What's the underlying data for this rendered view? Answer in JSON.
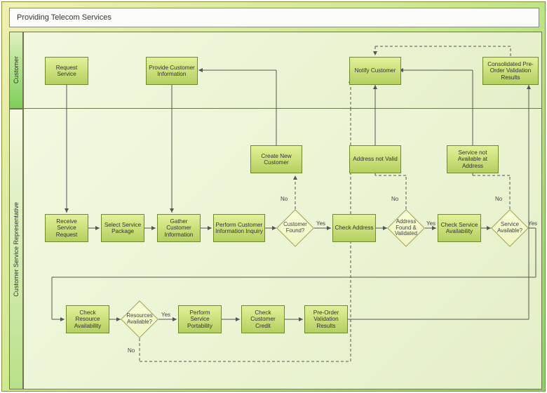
{
  "title": "Providing Telecom Services",
  "lanes": {
    "customer": "Customer",
    "csr": "Customer Service Representative"
  },
  "tasks": {
    "request_service": "Request Service",
    "provide_info": "Provide Customer Information",
    "notify_customer": "Notify Customer",
    "consolidated": "Consolidated Pre-Order Validation Results",
    "receive_request": "Receive Service Request",
    "select_package": "Select Service Package",
    "gather_info": "Gather Customer Information",
    "perform_inquiry": "Perform Customer Information Inquiry",
    "create_customer": "Create New Customer",
    "check_address": "Check Address",
    "addr_not_valid": "Address not Valid",
    "check_service": "Check Service Availability",
    "svc_not_avail": "Service not Available at Address",
    "check_resource": "Check Resource Availability",
    "perform_port": "Perform Service Portability",
    "check_credit": "Check Customer Credit",
    "preorder_results": "Pre-Order Validation Results"
  },
  "gateways": {
    "customer_found": "Customer Found?",
    "addr_validated": "Address Found & Validated",
    "service_avail": "Service Available?",
    "resources_avail": "Resources Available?"
  },
  "labels": {
    "yes": "Yes",
    "no": "No"
  },
  "chart_data": {
    "type": "table",
    "description": "BPMN swimlane flowchart with two lanes: Customer and Customer Service Representative",
    "nodes": [
      {
        "id": "request_service",
        "lane": "customer",
        "type": "task",
        "label": "Request Service"
      },
      {
        "id": "provide_info",
        "lane": "customer",
        "type": "task",
        "label": "Provide Customer Information"
      },
      {
        "id": "notify_customer",
        "lane": "customer",
        "type": "task",
        "label": "Notify Customer"
      },
      {
        "id": "consolidated",
        "lane": "customer",
        "type": "task",
        "label": "Consolidated Pre-Order Validation Results"
      },
      {
        "id": "receive_request",
        "lane": "csr",
        "type": "task",
        "label": "Receive Service Request"
      },
      {
        "id": "select_package",
        "lane": "csr",
        "type": "task",
        "label": "Select Service Package"
      },
      {
        "id": "gather_info",
        "lane": "csr",
        "type": "task",
        "label": "Gather Customer Information"
      },
      {
        "id": "perform_inquiry",
        "lane": "csr",
        "type": "task",
        "label": "Perform Customer Information Inquiry"
      },
      {
        "id": "customer_found",
        "lane": "csr",
        "type": "gateway",
        "label": "Customer Found?"
      },
      {
        "id": "create_customer",
        "lane": "csr",
        "type": "task",
        "label": "Create New Customer"
      },
      {
        "id": "check_address",
        "lane": "csr",
        "type": "task",
        "label": "Check Address"
      },
      {
        "id": "addr_validated",
        "lane": "csr",
        "type": "gateway",
        "label": "Address Found & Validated"
      },
      {
        "id": "addr_not_valid",
        "lane": "csr",
        "type": "task",
        "label": "Address not Valid"
      },
      {
        "id": "check_service",
        "lane": "csr",
        "type": "task",
        "label": "Check Service Availability"
      },
      {
        "id": "service_avail",
        "lane": "csr",
        "type": "gateway",
        "label": "Service Available?"
      },
      {
        "id": "svc_not_avail",
        "lane": "csr",
        "type": "task",
        "label": "Service not Available at Address"
      },
      {
        "id": "check_resource",
        "lane": "csr",
        "type": "task",
        "label": "Check Resource Availability"
      },
      {
        "id": "resources_avail",
        "lane": "csr",
        "type": "gateway",
        "label": "Resources Available?"
      },
      {
        "id": "perform_port",
        "lane": "csr",
        "type": "task",
        "label": "Perform Service Portability"
      },
      {
        "id": "check_credit",
        "lane": "csr",
        "type": "task",
        "label": "Check Customer Credit"
      },
      {
        "id": "preorder_results",
        "lane": "csr",
        "type": "task",
        "label": "Pre-Order Validation Results"
      }
    ],
    "edges": [
      {
        "from": "request_service",
        "to": "receive_request"
      },
      {
        "from": "receive_request",
        "to": "select_package"
      },
      {
        "from": "select_package",
        "to": "gather_info"
      },
      {
        "from": "provide_info",
        "to": "gather_info"
      },
      {
        "from": "gather_info",
        "to": "perform_inquiry"
      },
      {
        "from": "perform_inquiry",
        "to": "customer_found"
      },
      {
        "from": "customer_found",
        "to": "check_address",
        "label": "Yes"
      },
      {
        "from": "customer_found",
        "to": "create_customer",
        "label": "No",
        "style": "dashed"
      },
      {
        "from": "create_customer",
        "to": "provide_info"
      },
      {
        "from": "check_address",
        "to": "addr_validated"
      },
      {
        "from": "addr_validated",
        "to": "check_service",
        "label": "Yes"
      },
      {
        "from": "addr_validated",
        "to": "addr_not_valid",
        "label": "No",
        "style": "dashed"
      },
      {
        "from": "addr_not_valid",
        "to": "notify_customer"
      },
      {
        "from": "check_service",
        "to": "service_avail"
      },
      {
        "from": "service_avail",
        "to": "check_resource",
        "label": "Yes"
      },
      {
        "from": "service_avail",
        "to": "svc_not_avail",
        "label": "No",
        "style": "dashed"
      },
      {
        "from": "svc_not_avail",
        "to": "notify_customer"
      },
      {
        "from": "check_resource",
        "to": "resources_avail"
      },
      {
        "from": "resources_avail",
        "to": "perform_port",
        "label": "Yes"
      },
      {
        "from": "resources_avail",
        "to": "notify_customer",
        "label": "No",
        "style": "dashed"
      },
      {
        "from": "perform_port",
        "to": "check_credit"
      },
      {
        "from": "check_credit",
        "to": "preorder_results"
      },
      {
        "from": "preorder_results",
        "to": "consolidated"
      },
      {
        "from": "consolidated",
        "to": "notify_customer",
        "style": "dashed"
      }
    ]
  }
}
